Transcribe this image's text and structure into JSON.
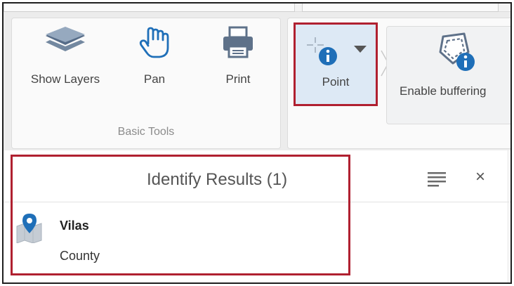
{
  "ribbon": {
    "basic_tools": {
      "group_label": "Basic Tools",
      "show_layers": {
        "label": "Show Layers",
        "icon": "layers-icon"
      },
      "pan": {
        "label": "Pan",
        "icon": "hand-icon"
      },
      "print": {
        "label": "Print",
        "icon": "printer-icon"
      }
    },
    "identify": {
      "point": {
        "label": "Point",
        "icon": "point-identify-icon",
        "selected": true
      },
      "enable_buffering": {
        "label": "Enable buffering",
        "icon": "buffer-icon"
      }
    }
  },
  "results_panel": {
    "title": "Identify Results (1)",
    "menu_icon": "hamburger-icon",
    "close_label": "×",
    "items": [
      {
        "name": "Vilas",
        "type": "County",
        "icon": "map-pin-icon"
      }
    ]
  },
  "colors": {
    "highlight_border": "#b02030",
    "selected_bg": "#dde9f5",
    "accent_blue": "#1f6fb8"
  }
}
